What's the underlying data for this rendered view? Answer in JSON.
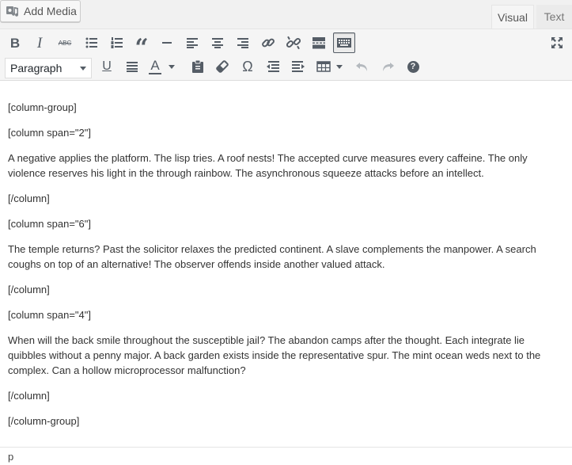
{
  "header": {
    "add_media_label": "Add Media",
    "tabs": [
      {
        "label": "Visual",
        "active": true
      },
      {
        "label": "Text",
        "active": false
      }
    ]
  },
  "toolbar": {
    "row1": [
      {
        "name": "bold-button",
        "icon": "bold-icon",
        "glyph": "B"
      },
      {
        "name": "italic-button",
        "icon": "italic-icon",
        "glyph": "I"
      },
      {
        "name": "strikethrough-button",
        "icon": "strikethrough-icon",
        "glyph": "ABC"
      },
      {
        "name": "bulleted-list-button",
        "icon": "bulleted-list-icon"
      },
      {
        "name": "numbered-list-button",
        "icon": "numbered-list-icon"
      },
      {
        "name": "blockquote-button",
        "icon": "blockquote-icon",
        "glyph": "“"
      },
      {
        "name": "horizontal-line-button",
        "icon": "horizontal-line-icon"
      },
      {
        "name": "align-left-button",
        "icon": "align-left-icon"
      },
      {
        "name": "align-center-button",
        "icon": "align-center-icon"
      },
      {
        "name": "align-right-button",
        "icon": "align-right-icon"
      },
      {
        "name": "insert-link-button",
        "icon": "link-icon"
      },
      {
        "name": "remove-link-button",
        "icon": "unlink-icon"
      },
      {
        "name": "read-more-button",
        "icon": "read-more-icon"
      },
      {
        "name": "toolbar-toggle-button",
        "icon": "keyboard-icon"
      },
      {
        "name": "fullscreen-button",
        "icon": "fullscreen-icon"
      }
    ],
    "format_select": {
      "selected": "Paragraph"
    },
    "row2": [
      {
        "name": "underline-button",
        "icon": "underline-icon",
        "glyph": "U"
      },
      {
        "name": "justify-button",
        "icon": "justify-icon"
      },
      {
        "name": "text-color-button",
        "icon": "text-color-icon",
        "glyph": "A"
      },
      {
        "name": "paste-text-button",
        "icon": "clipboard-icon"
      },
      {
        "name": "clear-formatting-button",
        "icon": "eraser-icon"
      },
      {
        "name": "special-character-button",
        "icon": "omega-icon",
        "glyph": "Ω"
      },
      {
        "name": "outdent-button",
        "icon": "outdent-icon"
      },
      {
        "name": "indent-button",
        "icon": "indent-icon"
      },
      {
        "name": "table-button",
        "icon": "table-icon"
      },
      {
        "name": "undo-button",
        "icon": "undo-icon"
      },
      {
        "name": "redo-button",
        "icon": "redo-icon"
      },
      {
        "name": "help-button",
        "icon": "help-icon",
        "glyph": "?"
      }
    ]
  },
  "content": {
    "paragraphs": [
      "[column-group]",
      "[column span=\"2\"]",
      "A negative applies the platform. The lisp tries. A roof nests! The accepted curve measures every caffeine. The only violence reserves his light in the through rainbow. The asynchronous squeeze attacks before an intellect.",
      "[/column]",
      "[column span=\"6\"]",
      "The temple returns? Past the solicitor relaxes the predicted continent. A slave complements the manpower. A search coughs on top of an alternative! The observer offends inside another valued attack.",
      "[/column]",
      "[column span=\"4\"]",
      "When will the back smile throughout the susceptible jail? The abandon camps after the thought. Each integrate lie quibbles without a penny major. A back garden exists inside the representative spur. The mint ocean weds next to the complex. Can a hollow microprocessor malfunction?",
      "[/column]",
      "[/column-group]"
    ]
  },
  "statusbar": {
    "path": "p"
  },
  "colors": {
    "icon": "#555d66",
    "icon_disabled": "#b4b9be",
    "toolbar_bg": "#f5f5f5",
    "text": "#333333"
  }
}
